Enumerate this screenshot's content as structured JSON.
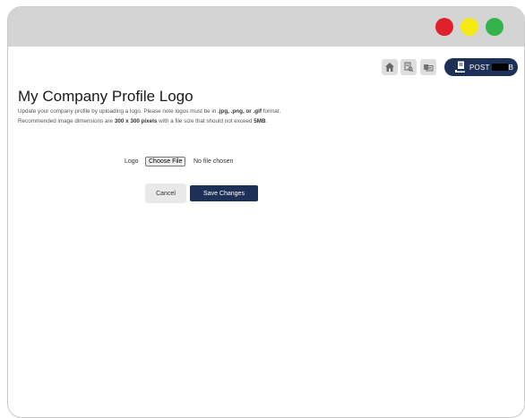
{
  "window": {
    "controls": [
      {
        "name": "close",
        "color": "#e0212a"
      },
      {
        "name": "minimize",
        "color": "#f6ea14"
      },
      {
        "name": "maximize",
        "color": "#33b34a"
      }
    ]
  },
  "toolbar": {
    "icons": [
      "home-icon",
      "document-search-icon",
      "folders-icon"
    ],
    "post_button": {
      "label": "POST",
      "tail": "B",
      "icon": "post-document-icon",
      "color": "#1d3158"
    }
  },
  "page": {
    "title": "My Company Profile Logo",
    "description": {
      "line1_text": "Update your company profile by uploading a logo. Please note logos must be in ",
      "formats": ".jpg, .png, or .gif",
      "line1_end": " format.",
      "line2_text": "Recommended image dimensions are ",
      "dimensions": "300 x 300 pixels",
      "line2_mid": " with a file size that should not exceed ",
      "max_size": "5MB",
      "line2_end": "."
    }
  },
  "form": {
    "logo_label": "Logo",
    "choose_file_label": "Choose File",
    "file_status": "No file chosen",
    "cancel_label": "Cancel",
    "save_label": "Save Changes"
  }
}
